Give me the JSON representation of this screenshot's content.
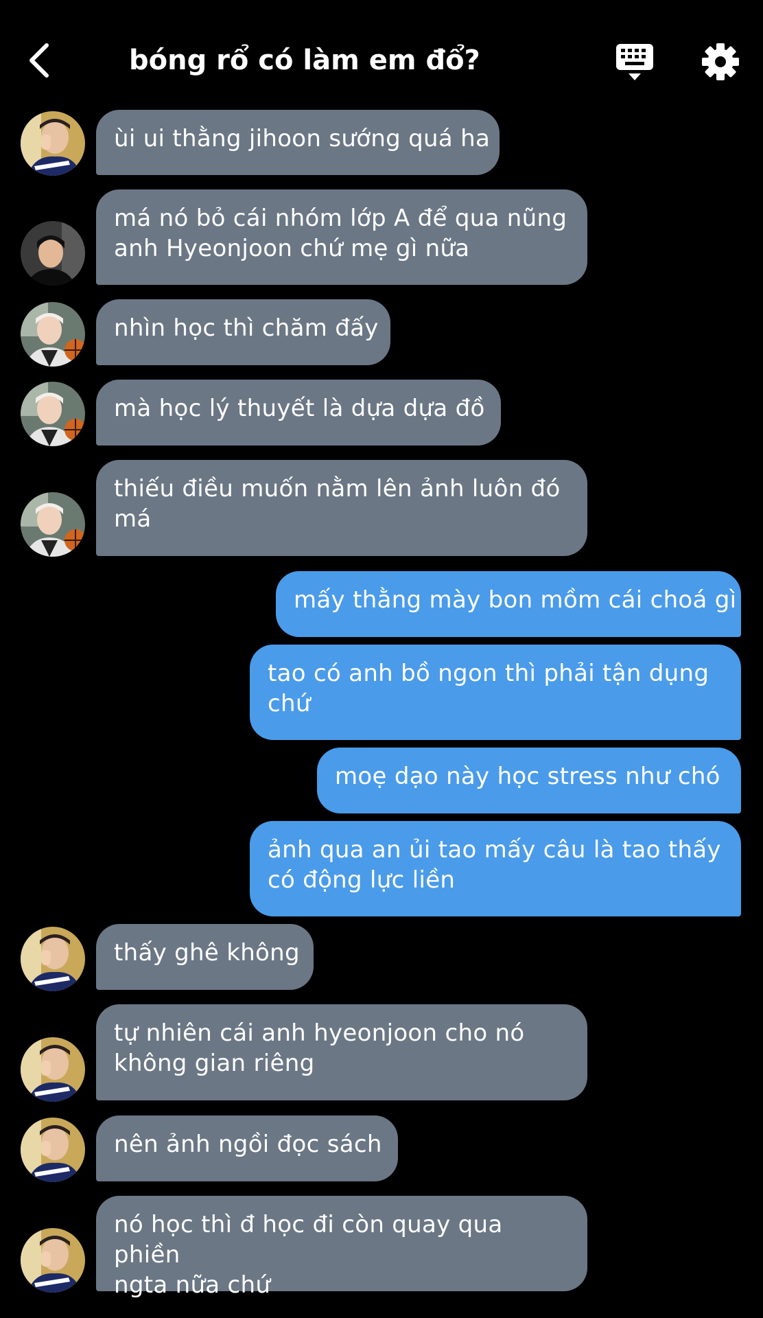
{
  "header": {
    "title": "bóng rổ có làm em đổ?",
    "back_icon": "chevron-left-icon",
    "keyboard_icon": "keyboard-icon",
    "settings_icon": "gear-icon"
  },
  "colors": {
    "background": "#000000",
    "incoming_bubble": "#6b7785",
    "outgoing_bubble": "#4a9be9",
    "text": "#ffffff"
  },
  "messages": [
    {
      "side": "in",
      "avatar": "avatar-boy-peace-sign",
      "text": "ùi ui thằng jihoon sướng quá ha"
    },
    {
      "side": "in",
      "avatar": "avatar-boy-dark",
      "text": "má nó bỏ cái nhóm lớp A để qua nũng\nanh Hyeonjoon chứ mẹ gì nữa"
    },
    {
      "side": "in",
      "avatar": "avatar-boy-basketball",
      "text": "nhìn học thì chăm đấy"
    },
    {
      "side": "in",
      "avatar": "avatar-boy-basketball",
      "text": "mà học lý thuyết là dựa dựa đồ"
    },
    {
      "side": "in",
      "avatar": "avatar-boy-basketball",
      "text": "thiếu điều muốn nằm lên ảnh luôn đó\nmá"
    },
    {
      "side": "out",
      "text": "mấy thằng mày bon mồm cái choá gì"
    },
    {
      "side": "out",
      "text": "tao có anh bồ ngon thì phải tận dụng\nchứ"
    },
    {
      "side": "out",
      "text": "moẹ dạo này học stress như chó"
    },
    {
      "side": "out",
      "text": "ảnh qua an ủi tao mấy câu là tao thấy\ncó động lực liền"
    },
    {
      "side": "in",
      "avatar": "avatar-boy-peace-sign",
      "text": "thấy ghê không"
    },
    {
      "side": "in",
      "avatar": "avatar-boy-peace-sign",
      "text": "tự nhiên cái anh hyeonjoon cho nó\nkhông gian riêng"
    },
    {
      "side": "in",
      "avatar": "avatar-boy-peace-sign",
      "text": "nên ảnh ngồi đọc sách"
    },
    {
      "side": "in",
      "avatar": "avatar-boy-peace-sign",
      "text": "nó học thì đ học đi còn quay qua phiền\nngta nữa chứ"
    }
  ]
}
